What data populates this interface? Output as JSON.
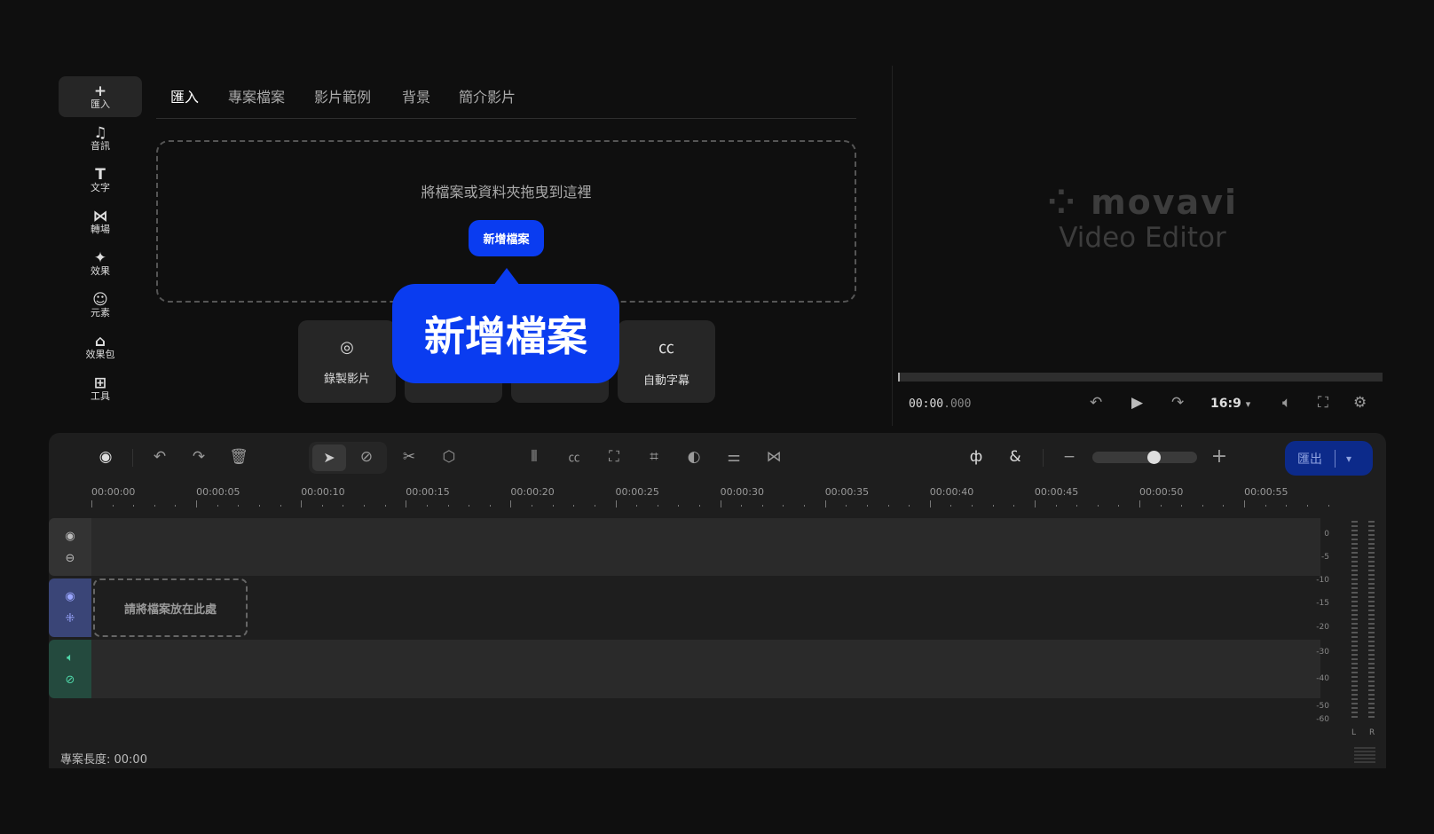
{
  "sidebar": {
    "items": [
      {
        "icon": "plus-icon",
        "glyph": "+",
        "label": "匯入"
      },
      {
        "icon": "music-icon",
        "glyph": "♫",
        "label": "音訊"
      },
      {
        "icon": "text-icon",
        "glyph": "T",
        "label": "文字"
      },
      {
        "icon": "transition-icon",
        "glyph": "⋈",
        "label": "轉場"
      },
      {
        "icon": "sparkle-icon",
        "glyph": "✦",
        "label": "效果"
      },
      {
        "icon": "smiley-icon",
        "glyph": "☺",
        "label": "元素"
      },
      {
        "icon": "bag-plus-icon",
        "glyph": "⌂",
        "label": "效果包"
      },
      {
        "icon": "grid-plus-icon",
        "glyph": "⊞",
        "label": "工具"
      }
    ]
  },
  "tabs": [
    "匯入",
    "專案檔案",
    "影片範例",
    "背景",
    "簡介影片"
  ],
  "dropzone": {
    "text": "將檔案或資料夾拖曳到這裡",
    "button": "新增檔案"
  },
  "callout": "新增檔案",
  "cards": [
    {
      "label": "錄製影片",
      "icon": "webcam-icon"
    },
    {
      "label": "",
      "icon": ""
    },
    {
      "label": "",
      "icon": ""
    },
    {
      "label": "自動字幕",
      "icon": "cc-icon"
    }
  ],
  "preview": {
    "brand": "movavi",
    "product": "Video Editor",
    "time_main": "00:00",
    "time_ms": ".000",
    "aspect": "16:9",
    "progress": 0
  },
  "timeline": {
    "ruler": [
      "00:00:00",
      "00:00:05",
      "00:00:10",
      "00:00:15",
      "00:00:20",
      "00:00:25",
      "00:00:30",
      "00:00:35",
      "00:00:40",
      "00:00:45",
      "00:00:50",
      "00:00:55"
    ],
    "drop_text": "請將檔案放在此處",
    "export": "匯出",
    "zoom_level": 0.6,
    "meter": [
      "0",
      "-5",
      "-10",
      "-15",
      "-20",
      "-30",
      "-40",
      "-50",
      "-60"
    ],
    "meter_channels": [
      "L",
      "R"
    ],
    "footer": "專案長度: 00:00",
    "colors": {
      "accent": "#0a3cf0",
      "video_track": "#3a4577",
      "audio_track": "#244a3e"
    }
  }
}
